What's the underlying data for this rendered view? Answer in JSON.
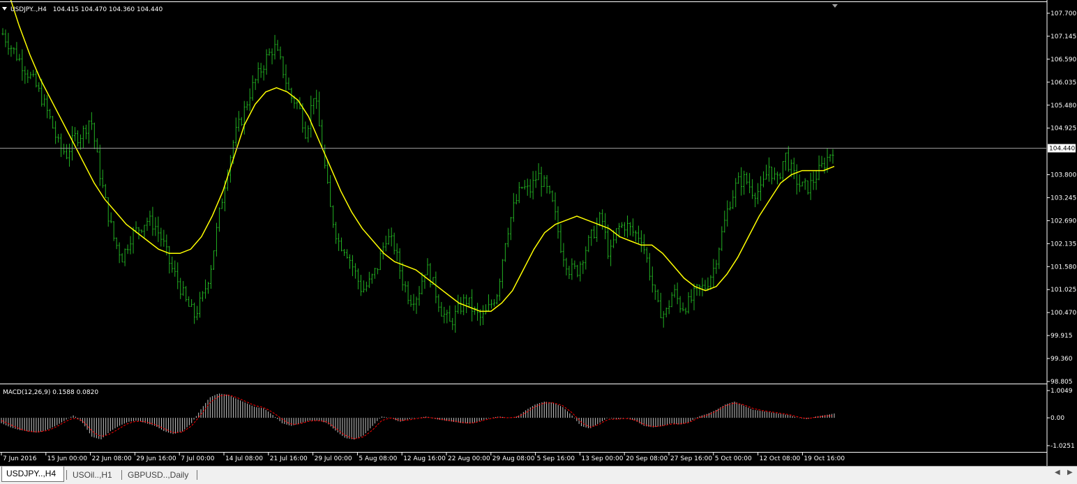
{
  "main_header": {
    "symbol_label": "USDJPY..,H4",
    "ohlc_text": "104.415 104.470 104.360 104.440",
    "menu_icon": "triangle-down-icon"
  },
  "macd_header": {
    "label": "MACD(12,26,9) 0.1588 0.0820"
  },
  "price_axis": {
    "ticks": [
      "107.700",
      "107.145",
      "106.590",
      "106.035",
      "105.480",
      "104.925",
      "103.800",
      "103.245",
      "102.690",
      "102.135",
      "101.580",
      "101.025",
      "100.470",
      "99.915",
      "99.360",
      "98.805"
    ],
    "current_price_label": "104.440"
  },
  "macd_axis": {
    "ticks": [
      "1.0049",
      "0.00",
      "-1.0251"
    ]
  },
  "time_axis": {
    "labels": [
      "7 Jun 2016",
      "15 Jun 00:00",
      "22 Jun 08:00",
      "29 Jun 16:00",
      "7 Jul 00:00",
      "14 Jul 08:00",
      "21 Jul 16:00",
      "29 Jul 00:00",
      "5 Aug 08:00",
      "12 Aug 16:00",
      "22 Aug 00:00",
      "29 Aug 08:00",
      "5 Sep 16:00",
      "13 Sep 00:00",
      "20 Sep 08:00",
      "27 Sep 16:00",
      "5 Oct 00:00",
      "12 Oct 08:00",
      "19 Oct 16:00"
    ]
  },
  "tabs": [
    {
      "label": "USDJPY..,H4",
      "active": true
    },
    {
      "label": "USOil..,H1",
      "active": false
    },
    {
      "label": "GBPUSD..,Daily",
      "active": false
    }
  ],
  "scroll_icons": [
    "scroll-left-icon",
    "scroll-right-icon"
  ],
  "colors": {
    "background": "#000000",
    "bars": "#22b022",
    "moving_average": "#ffff00",
    "axis_text": "#ffffff",
    "grid_line": "#ffffff",
    "macd_histogram": "#c8c8c8",
    "macd_signal": "#ff0000",
    "current_price_box": "#ffffff"
  },
  "chart_data": [
    {
      "type": "line",
      "chart_style": "bar",
      "title": "USDJPY..,H4",
      "ylim": [
        98.805,
        107.7
      ],
      "x_labels": [
        "7 Jun 2016",
        "15 Jun 00:00",
        "22 Jun 08:00",
        "29 Jun 16:00",
        "7 Jul 00:00",
        "14 Jul 08:00",
        "21 Jul 16:00",
        "29 Jul 00:00",
        "5 Aug 08:00",
        "12 Aug 16:00",
        "22 Aug 00:00",
        "29 Aug 08:00",
        "5 Sep 16:00",
        "13 Sep 00:00",
        "20 Sep 08:00",
        "27 Sep 16:00",
        "5 Oct 00:00",
        "12 Oct 08:00",
        "19 Oct 16:00"
      ],
      "current_price": 104.44,
      "last_bar": {
        "open": 104.415,
        "high": 104.47,
        "low": 104.36,
        "close": 104.44
      },
      "series": [
        {
          "values": [
            107.2,
            106.9,
            106.6,
            106.3,
            106.0,
            105.6,
            105.1,
            104.5,
            104.3,
            104.7,
            104.8,
            105.2,
            104.0,
            103.0,
            102.2,
            101.8,
            102.3,
            102.5,
            102.7,
            102.6,
            102.2,
            101.6,
            101.2,
            100.7,
            100.4,
            100.8,
            101.5,
            102.7,
            103.8,
            104.7,
            105.2,
            105.8,
            106.2,
            106.6,
            106.9,
            106.4,
            105.7,
            105.5,
            104.8,
            105.8,
            104.5,
            103.0,
            102.2,
            102.0,
            101.5,
            101.0,
            101.2,
            101.6,
            102.3,
            102.1,
            101.3,
            100.8,
            100.9,
            101.6,
            101.1,
            100.5,
            100.2,
            100.5,
            100.8,
            100.5,
            100.3,
            100.6,
            101.0,
            102.3,
            103.0,
            103.5,
            103.4,
            103.8,
            103.5,
            103.0,
            102.0,
            101.5,
            101.5,
            102.0,
            102.4,
            102.8,
            101.8,
            102.5,
            102.6,
            102.4,
            102.3,
            101.5,
            100.6,
            100.4,
            101.0,
            100.6,
            100.7,
            101.0,
            101.1,
            101.5,
            102.3,
            103.1,
            103.6,
            103.7,
            103.4,
            103.4,
            104.0,
            103.6,
            104.3,
            103.8,
            103.5,
            103.5,
            103.8,
            104.1,
            104.44
          ],
          "name": ""
        },
        {
          "values": [
            108.2,
            107.4,
            106.7,
            106.1,
            105.6,
            105.1,
            104.6,
            104.1,
            103.6,
            103.2,
            102.9,
            102.6,
            102.4,
            102.2,
            102.0,
            101.9,
            101.9,
            102.0,
            102.3,
            102.8,
            103.4,
            104.2,
            105.0,
            105.5,
            105.8,
            105.9,
            105.8,
            105.6,
            105.2,
            104.6,
            104.0,
            103.4,
            102.9,
            102.5,
            102.2,
            101.9,
            101.7,
            101.6,
            101.5,
            101.3,
            101.1,
            100.9,
            100.7,
            100.6,
            100.5,
            100.5,
            100.7,
            101.0,
            101.5,
            102.0,
            102.4,
            102.6,
            102.7,
            102.8,
            102.7,
            102.6,
            102.5,
            102.3,
            102.2,
            102.1,
            102.1,
            101.9,
            101.6,
            101.3,
            101.1,
            101.0,
            101.1,
            101.4,
            101.8,
            102.3,
            102.8,
            103.2,
            103.6,
            103.8,
            103.9,
            103.9,
            103.9,
            104.0
          ],
          "name": ""
        }
      ]
    },
    {
      "type": "bar",
      "title": "MACD(12,26,9) 0.1588 0.0820",
      "ylim": [
        -1.0251,
        1.0049
      ],
      "macd_value": 0.1588,
      "signal_value": 0.082,
      "series": [
        {
          "values": [
            -0.2,
            -0.35,
            -0.45,
            -0.5,
            -0.55,
            -0.45,
            -0.3,
            -0.1,
            0.1,
            -0.2,
            -0.7,
            -0.8,
            -0.5,
            -0.3,
            -0.15,
            -0.1,
            -0.2,
            -0.3,
            -0.5,
            -0.6,
            -0.5,
            -0.2,
            0.3,
            0.75,
            0.9,
            0.85,
            0.7,
            0.55,
            0.4,
            0.35,
            0.1,
            -0.2,
            -0.3,
            -0.2,
            -0.1,
            -0.1,
            -0.2,
            -0.5,
            -0.75,
            -0.8,
            -0.65,
            -0.3,
            0.05,
            0.0,
            -0.15,
            -0.05,
            0.0,
            0.05,
            -0.05,
            -0.1,
            -0.15,
            -0.2,
            -0.2,
            -0.1,
            0.0,
            0.05,
            0.0,
            0.05,
            0.3,
            0.5,
            0.6,
            0.55,
            0.4,
            0.1,
            -0.3,
            -0.4,
            -0.2,
            0.0,
            -0.05,
            0.0,
            -0.1,
            -0.3,
            -0.35,
            -0.3,
            -0.2,
            -0.25,
            -0.15,
            0.05,
            0.15,
            0.3,
            0.5,
            0.6,
            0.45,
            0.3,
            0.25,
            0.2,
            0.15,
            0.1,
            0.0,
            -0.05,
            0.05,
            0.1,
            0.1589
          ],
          "name": ""
        },
        {
          "values": [
            -0.1,
            -0.25,
            -0.4,
            -0.5,
            -0.52,
            -0.48,
            -0.35,
            -0.15,
            0.0,
            -0.1,
            -0.5,
            -0.7,
            -0.6,
            -0.4,
            -0.2,
            -0.12,
            -0.15,
            -0.25,
            -0.4,
            -0.55,
            -0.52,
            -0.3,
            0.1,
            0.55,
            0.8,
            0.85,
            0.75,
            0.6,
            0.45,
            0.38,
            0.2,
            -0.05,
            -0.25,
            -0.22,
            -0.12,
            -0.1,
            -0.15,
            -0.4,
            -0.65,
            -0.78,
            -0.7,
            -0.45,
            -0.1,
            0.0,
            -0.1,
            -0.08,
            -0.02,
            0.02,
            -0.02,
            -0.08,
            -0.12,
            -0.18,
            -0.2,
            -0.12,
            -0.03,
            0.02,
            0.0,
            0.03,
            0.2,
            0.42,
            0.55,
            0.55,
            0.45,
            0.2,
            -0.15,
            -0.35,
            -0.25,
            -0.05,
            -0.05,
            -0.02,
            -0.08,
            -0.25,
            -0.33,
            -0.3,
            -0.22,
            -0.23,
            -0.17,
            0.0,
            0.1,
            0.25,
            0.45,
            0.55,
            0.48,
            0.35,
            0.27,
            0.22,
            0.17,
            0.12,
            0.03,
            -0.03,
            0.02,
            0.07,
            0.082
          ],
          "name": ""
        }
      ]
    }
  ]
}
